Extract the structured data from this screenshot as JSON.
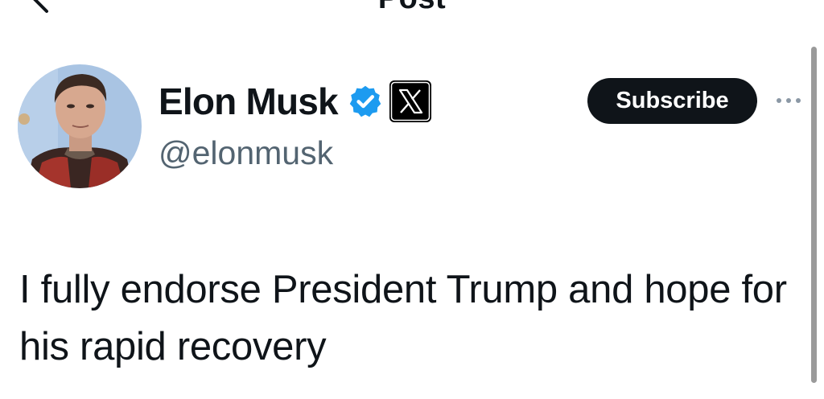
{
  "nav": {
    "title": "Post",
    "back_icon": "chevron-left-icon"
  },
  "author": {
    "display_name": "Elon Musk",
    "handle": "@elonmusk",
    "verified_icon": "verified-badge-icon",
    "verified_color": "#1d9bf0",
    "affiliate_icon": "x-logo-icon"
  },
  "actions": {
    "subscribe_label": "Subscribe",
    "more_icon": "more-dots-icon"
  },
  "post": {
    "text": "I fully endorse President Trump and hope for his rapid recovery"
  }
}
